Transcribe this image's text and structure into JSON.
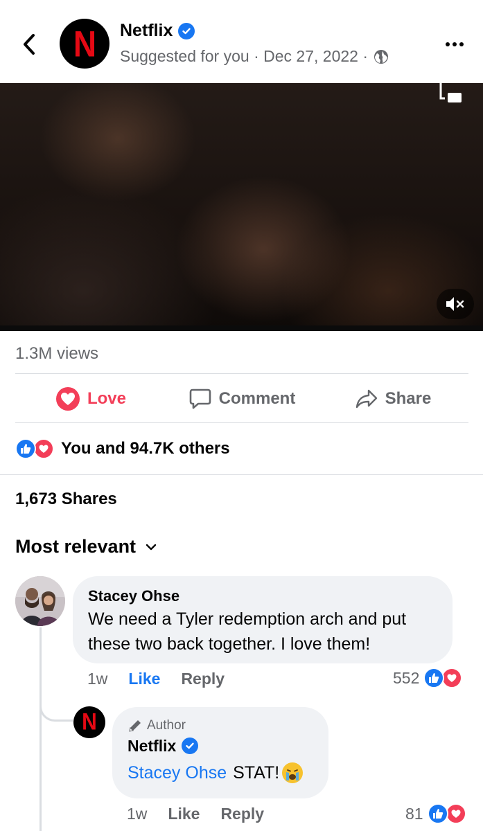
{
  "header": {
    "page_name": "Netflix",
    "avatar_letter": "N",
    "subtitle": "Suggested for you · Dec 27, 2022 ·"
  },
  "post": {
    "views": "1.3M views",
    "actions": {
      "love_label": "Love",
      "comment_label": "Comment",
      "share_label": "Share"
    },
    "reactions_text": "You and 94.7K others",
    "shares_text": "1,673 Shares"
  },
  "comments": {
    "sort_label": "Most relevant",
    "items": [
      {
        "author": "Stacey Ohse",
        "text": "We need a Tyler redemption arch and put these two back together. I love them!",
        "time": "1w",
        "like_label": "Like",
        "reply_label": "Reply",
        "reaction_count": "552"
      }
    ],
    "reply": {
      "badge": "Author",
      "author": "Netflix",
      "avatar_letter": "N",
      "mention": "Stacey Ohse",
      "text": " STAT!",
      "time": "1w",
      "like_label": "Like",
      "reply_label": "Reply",
      "reaction_count": "81"
    }
  },
  "colors": {
    "accent_blue": "#1877f2",
    "love_red": "#f33e58",
    "netflix_red": "#e50914",
    "meta_gray": "#65676b"
  }
}
